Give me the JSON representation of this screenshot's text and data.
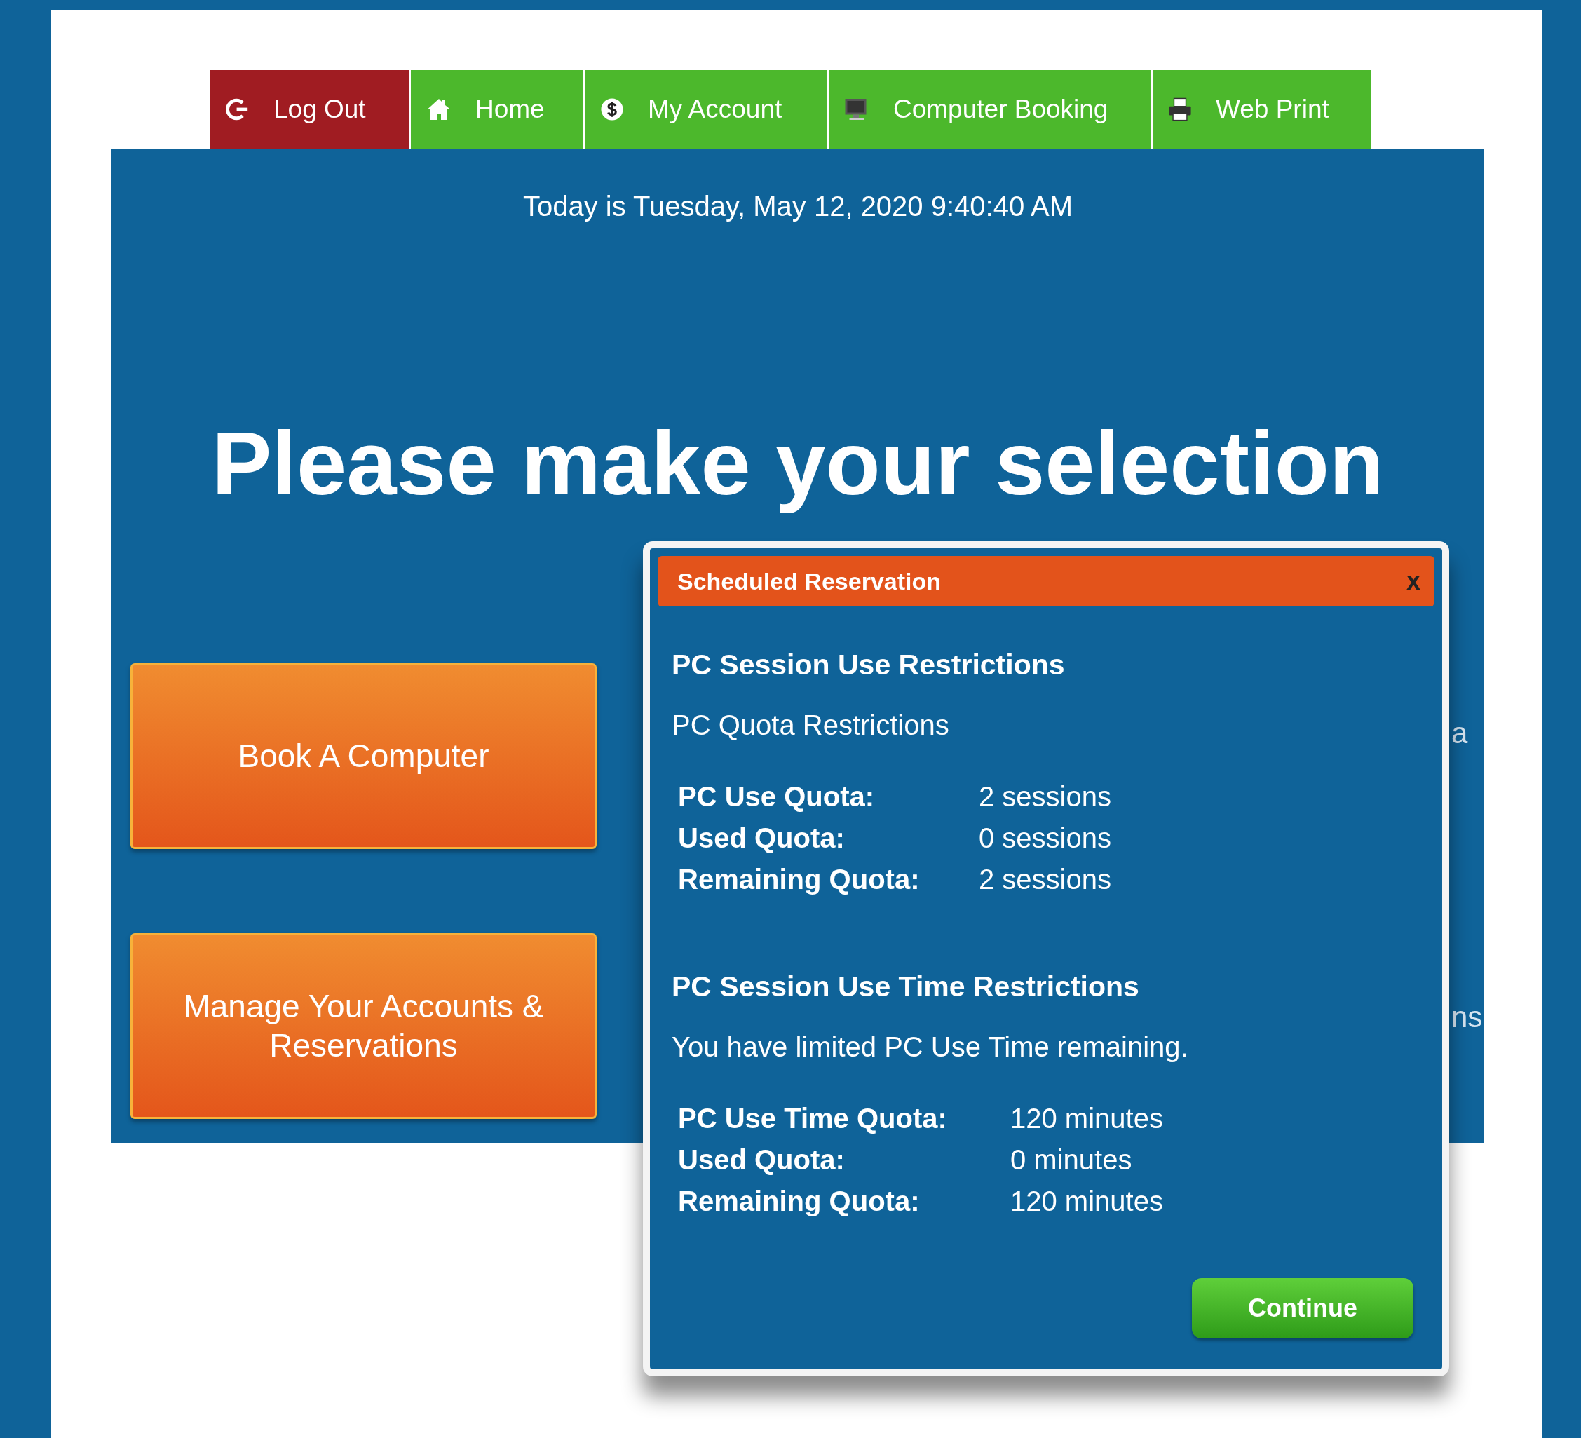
{
  "nav_tabs": [
    {
      "label": "Log Out",
      "kind": "logout",
      "color": "#a01c22"
    },
    {
      "label": "Home",
      "kind": "home",
      "color": "#4cb82c"
    },
    {
      "label": "My Account",
      "kind": "account",
      "color": "#4cb82c"
    },
    {
      "label": "Computer Booking",
      "kind": "booking",
      "color": "#4cb82c"
    },
    {
      "label": "Web Print",
      "kind": "print",
      "color": "#4cb82c"
    }
  ],
  "date_text": "Today is Tuesday, May 12, 2020 9:40:40 AM",
  "heading": "Please make your selection",
  "action_buttons": [
    "Book A Computer",
    "Manage Your Accounts & Reservations"
  ],
  "background_fragments": [
    "a",
    "ns"
  ],
  "dialog": {
    "title": "Scheduled Reservation",
    "close": "x",
    "sections": [
      {
        "heading": "PC Session Use Restrictions",
        "intro": "PC Quota Restrictions",
        "rows": [
          {
            "label": "PC Use Quota:",
            "value": "2 sessions"
          },
          {
            "label": "Used Quota:",
            "value": "0 sessions"
          },
          {
            "label": "Remaining Quota:",
            "value": "2 sessions"
          }
        ]
      },
      {
        "heading": "PC Session Use Time Restrictions",
        "intro": "You have limited PC Use Time remaining.",
        "rows": [
          {
            "label": "PC Use Time Quota:",
            "value": "120 minutes"
          },
          {
            "label": "Used Quota:",
            "value": "0 minutes"
          },
          {
            "label": "Remaining Quota:",
            "value": "120 minutes"
          }
        ]
      }
    ],
    "button": "Continue"
  }
}
